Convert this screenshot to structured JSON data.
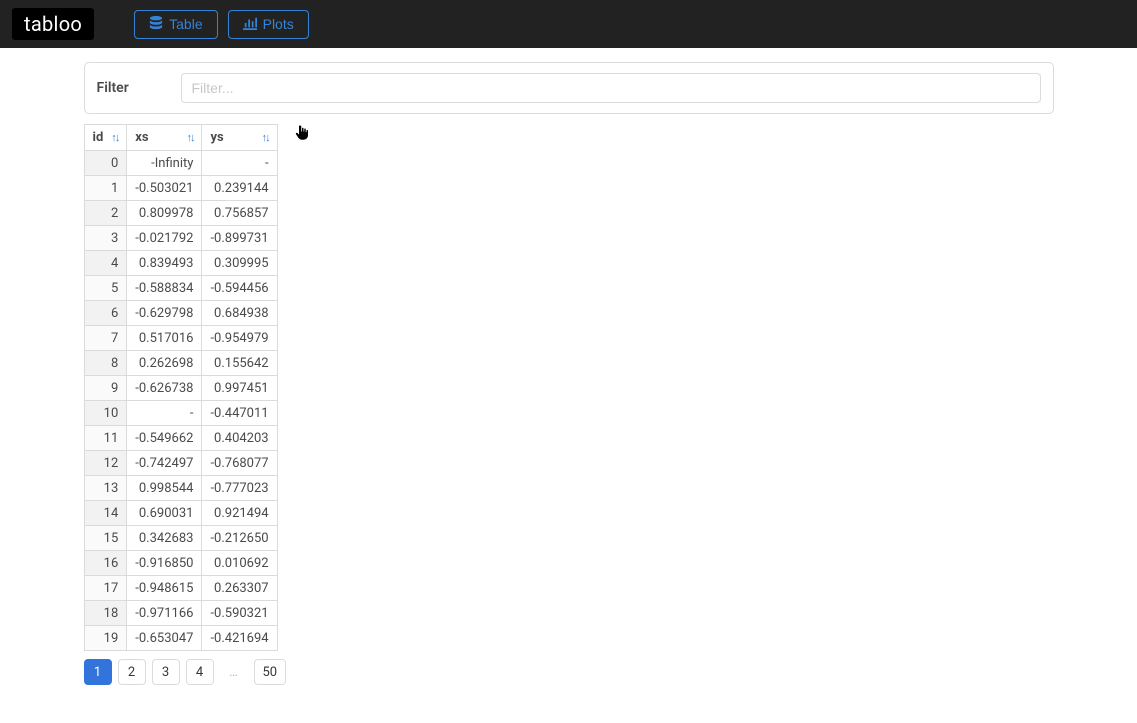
{
  "navbar": {
    "brand": "tabloo",
    "table_btn": "Table",
    "plots_btn": "Plots"
  },
  "filter": {
    "label": "Filter",
    "placeholder": "Filter..."
  },
  "columns": [
    "id",
    "xs",
    "ys"
  ],
  "rows": [
    {
      "id": "0",
      "xs": "-Infinity",
      "ys": "-"
    },
    {
      "id": "1",
      "xs": "-0.503021",
      "ys": "0.239144"
    },
    {
      "id": "2",
      "xs": "0.809978",
      "ys": "0.756857"
    },
    {
      "id": "3",
      "xs": "-0.021792",
      "ys": "-0.899731"
    },
    {
      "id": "4",
      "xs": "0.839493",
      "ys": "0.309995"
    },
    {
      "id": "5",
      "xs": "-0.588834",
      "ys": "-0.594456"
    },
    {
      "id": "6",
      "xs": "-0.629798",
      "ys": "0.684938"
    },
    {
      "id": "7",
      "xs": "0.517016",
      "ys": "-0.954979"
    },
    {
      "id": "8",
      "xs": "0.262698",
      "ys": "0.155642"
    },
    {
      "id": "9",
      "xs": "-0.626738",
      "ys": "0.997451"
    },
    {
      "id": "10",
      "xs": "-",
      "ys": "-0.447011"
    },
    {
      "id": "11",
      "xs": "-0.549662",
      "ys": "0.404203"
    },
    {
      "id": "12",
      "xs": "-0.742497",
      "ys": "-0.768077"
    },
    {
      "id": "13",
      "xs": "0.998544",
      "ys": "-0.777023"
    },
    {
      "id": "14",
      "xs": "0.690031",
      "ys": "0.921494"
    },
    {
      "id": "15",
      "xs": "0.342683",
      "ys": "-0.212650"
    },
    {
      "id": "16",
      "xs": "-0.916850",
      "ys": "0.010692"
    },
    {
      "id": "17",
      "xs": "-0.948615",
      "ys": "0.263307"
    },
    {
      "id": "18",
      "xs": "-0.971166",
      "ys": "-0.590321"
    },
    {
      "id": "19",
      "xs": "-0.653047",
      "ys": "-0.421694"
    }
  ],
  "pagination": {
    "pages": [
      "1",
      "2",
      "3",
      "4"
    ],
    "ellipsis": "…",
    "last": "50",
    "active": "1"
  }
}
